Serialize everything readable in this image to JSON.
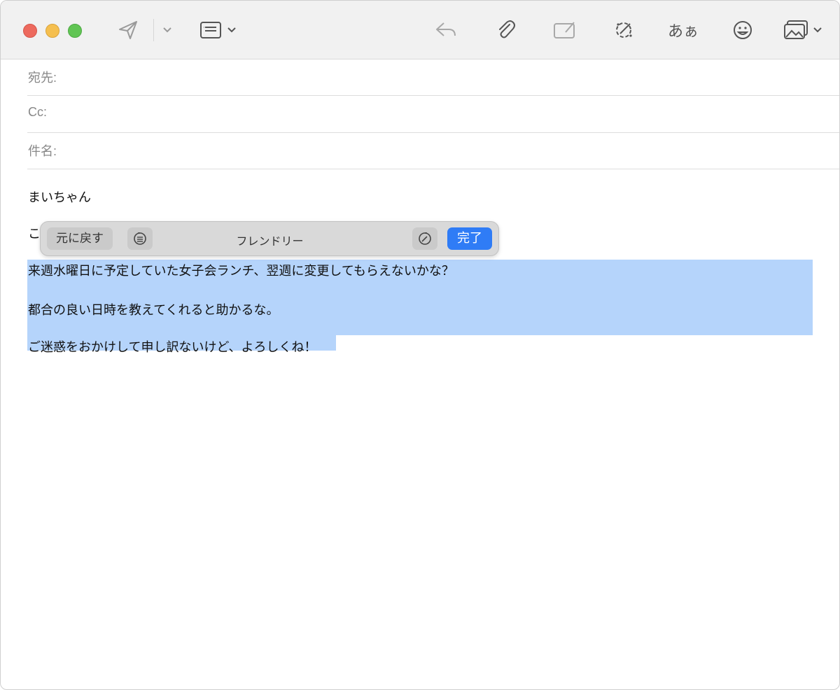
{
  "toolbar": {
    "icons": [
      "send-icon",
      "chevron-down-icon",
      "header-fields-icon",
      "chevron-down-icon",
      "reply-icon",
      "paperclip-icon",
      "markup-icon",
      "writing-tools-icon",
      "emoji-icon",
      "photo-browser-icon"
    ],
    "font_button_label": "あぁ"
  },
  "fields": {
    "to_label": "宛先:",
    "cc_label": "Cc:",
    "subject_label": "件名:"
  },
  "body": {
    "greeting": "まいちゃん",
    "line2_partial": "こ",
    "line3": "来週水曜日に予定していた女子会ランチ、翌週に変更してもらえないかな？",
    "line4": "都合の良い日時を教えてくれると助かるな。",
    "line5": "ご迷惑をおかけして申し訳ないけど、よろしくね！"
  },
  "writing_tools": {
    "revert_label": "元に戻す",
    "title": "フレンドリー",
    "done_label": "完了",
    "accent_color": "#2f7cf6"
  },
  "selection_color": "#b5d4fb"
}
